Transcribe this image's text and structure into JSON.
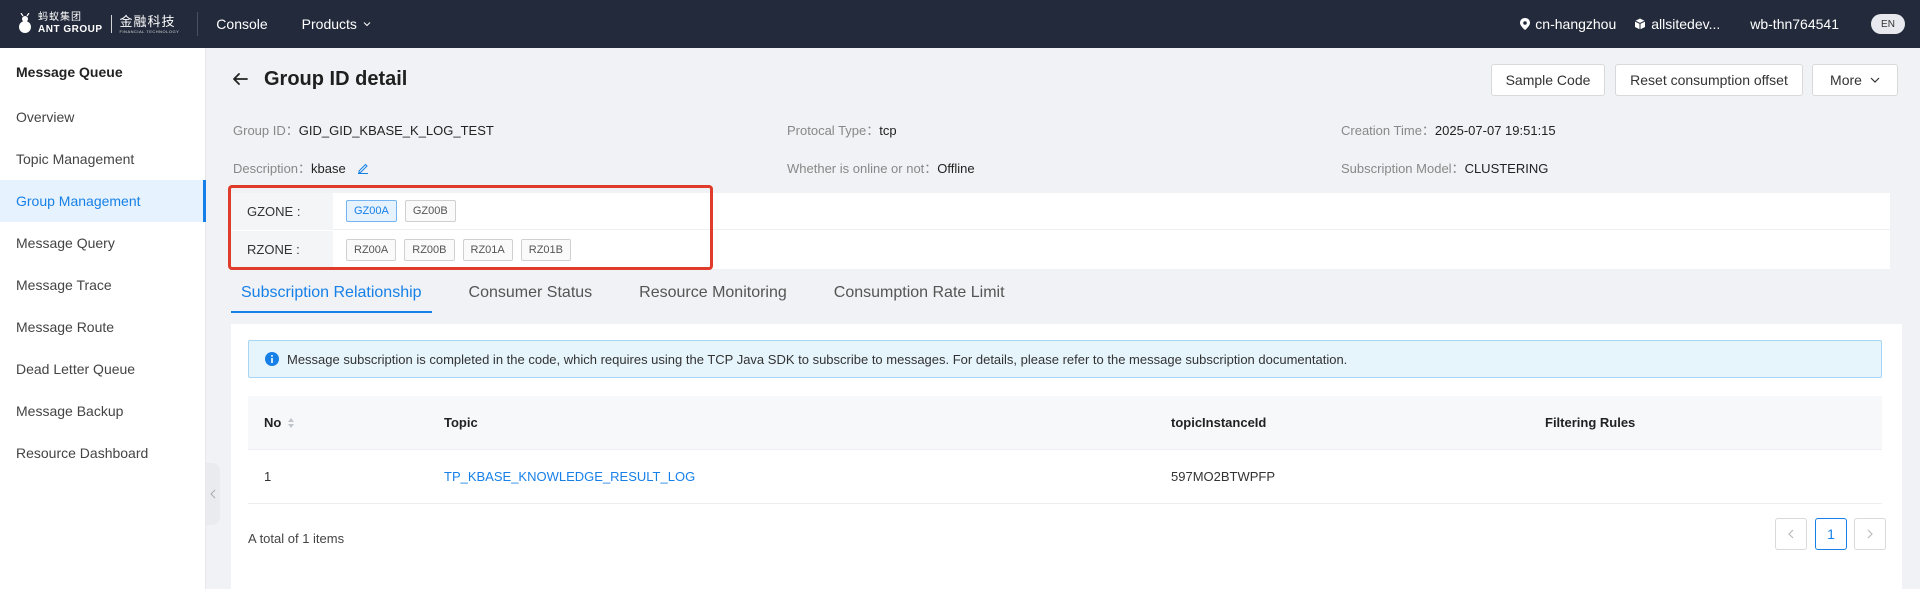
{
  "topbar": {
    "logo_cn": "蚂蚁集团",
    "logo_en": "ANT GROUP",
    "logo_fin_cn": "金融科技",
    "logo_fin_en": "FINANCIAL TECHNOLOGY",
    "console": "Console",
    "products": "Products",
    "region": "cn-hangzhou",
    "workspace": "allsitedev...",
    "user": "wb-thn764541",
    "lang": "EN"
  },
  "sidebar": {
    "title": "Message Queue",
    "items": [
      {
        "label": "Overview"
      },
      {
        "label": "Topic Management"
      },
      {
        "label": "Group Management",
        "active": true
      },
      {
        "label": "Message Query"
      },
      {
        "label": "Message Trace"
      },
      {
        "label": "Message Route"
      },
      {
        "label": "Dead Letter Queue"
      },
      {
        "label": "Message Backup"
      },
      {
        "label": "Resource Dashboard"
      }
    ]
  },
  "header": {
    "title": "Group ID detail",
    "buttons": {
      "sample": "Sample Code",
      "reset": "Reset consumption offset",
      "more": "More"
    }
  },
  "info": {
    "group_id": {
      "label": "Group ID：",
      "value": "GID_GID_KBASE_K_LOG_TEST"
    },
    "protocol": {
      "label": "Protocal Type：",
      "value": "tcp"
    },
    "creation": {
      "label": "Creation Time：",
      "value": "2025-07-07 19:51:15"
    },
    "description": {
      "label": "Description：",
      "value": "kbase"
    },
    "online": {
      "label": "Whether is online or not：",
      "value": "Offline"
    },
    "subscription_model": {
      "label": "Subscription Model：",
      "value": "CLUSTERING"
    }
  },
  "zones": {
    "gzone": {
      "label": "GZONE :",
      "tags": [
        "GZ00A",
        "GZ00B"
      ]
    },
    "rzone": {
      "label": "RZONE :",
      "tags": [
        "RZ00A",
        "RZ00B",
        "RZ01A",
        "RZ01B"
      ]
    }
  },
  "tabs": [
    "Subscription Relationship",
    "Consumer Status",
    "Resource Monitoring",
    "Consumption Rate Limit"
  ],
  "notice": "Message subscription is completed in the code, which requires using the TCP Java SDK to subscribe to messages. For details, please refer to the message subscription documentation.",
  "table": {
    "columns": [
      "No",
      "Topic",
      "topicInstanceId",
      "Filtering Rules"
    ],
    "rows": [
      {
        "no": "1",
        "topic": "TP_KBASE_KNOWLEDGE_RESULT_LOG",
        "instance": "597MO2BTWPFP",
        "rules": ""
      }
    ]
  },
  "footer": {
    "total": "A total of 1 items",
    "page": "1"
  },
  "colors": {
    "accent": "#1780e8",
    "topbar": "#232a3b",
    "highlight": "#e03c2c"
  }
}
